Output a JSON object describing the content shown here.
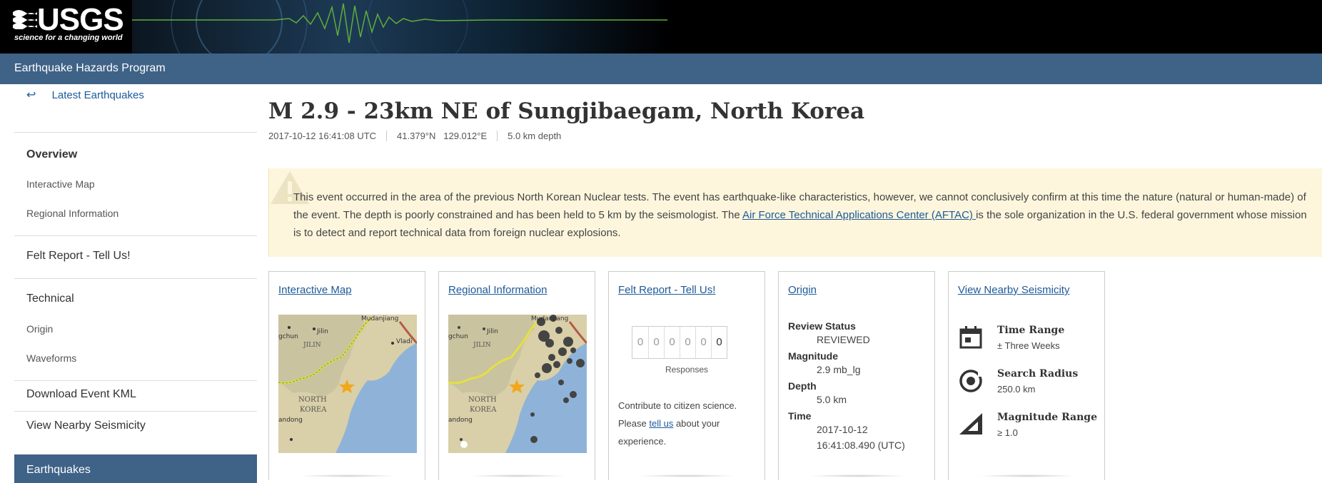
{
  "header": {
    "logo_word": "USGS",
    "logo_tagline": "science for a changing world",
    "program": "Earthquake Hazards Program"
  },
  "sidebar": {
    "back_arrow": "↩",
    "back_label": "Latest Earthquakes",
    "overview": "Overview",
    "interactive_map": "Interactive Map",
    "regional_information": "Regional Information",
    "felt_report": "Felt Report - Tell Us!",
    "technical": "Technical",
    "origin": "Origin",
    "waveforms": "Waveforms",
    "download_kml": "Download Event KML",
    "view_nearby": "View Nearby Seismicity",
    "earthquakes": "Earthquakes"
  },
  "event": {
    "title": "M 2.9 - 23km NE of Sungjibaegam, North Korea",
    "time": "2017-10-12 16:41:08 UTC",
    "lat": "41.379°N",
    "lon": "129.012°E",
    "depth": "5.0 km depth"
  },
  "notice": {
    "text_before": "This event occurred in the area of the previous North Korean Nuclear tests. The event has earthquake-like characteristics, however, we cannot conclusively confirm at this time the nature (natural or human-made) of the event. The depth is poorly constrained and has been held to 5 km by the seismologist. The ",
    "link": "Air Force Technical Applications Center (AFTAC) ",
    "text_after": "is the sole organization in the U.S. federal government whose mission is to detect and report technical data from foreign nuclear explosions."
  },
  "cards": {
    "interactive_map": "Interactive Map",
    "regional_information": "Regional Information",
    "felt_report": "Felt Report - Tell Us!",
    "origin": "Origin",
    "view_nearby": "View Nearby Seismicity"
  },
  "map_labels": {
    "mudanjiang": "Mudanjiang",
    "jilin": "Jilin",
    "jilin_province": "JILIN",
    "gchun": "gchun",
    "vladi": "Vladi",
    "north": "NORTH",
    "korea": "KOREA",
    "dandong": "andong"
  },
  "felt": {
    "digits": [
      "0",
      "0",
      "0",
      "0",
      "0",
      "0"
    ],
    "responses_label": "Responses",
    "contrib_line1": "Contribute to citizen science.",
    "contrib_please": "Please ",
    "contrib_link": "tell us",
    "contrib_after": " about your experience."
  },
  "origin": {
    "review_status_label": "Review Status",
    "review_status": "REVIEWED",
    "magnitude_label": "Magnitude",
    "magnitude": "2.9 mb_lg",
    "depth_label": "Depth",
    "depth": "5.0 km",
    "time_label": "Time",
    "time_date": "2017-10-12",
    "time_clock": "16:41:08.490 (UTC)"
  },
  "nearby": {
    "time_range_label": "Time Range",
    "time_range": "± Three Weeks",
    "radius_label": "Search Radius",
    "radius": "250.0 km",
    "mag_range_label": "Magnitude Range",
    "mag_range": "≥ 1.0"
  },
  "colors": {
    "header_blue": "#3f6287",
    "link": "#1d5a99",
    "notice_bg": "#fdf6dd",
    "map_sea": "#8fb3d8",
    "map_land": "#d9cfa8"
  }
}
